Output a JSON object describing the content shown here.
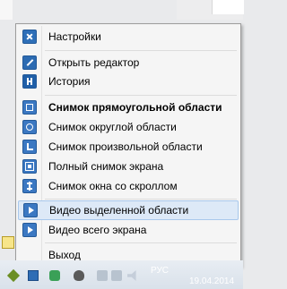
{
  "menu": {
    "items": [
      {
        "label": "Настройки",
        "icon": "settings-icon"
      },
      {
        "label": "Открыть редактор",
        "icon": "pencil-icon"
      },
      {
        "label": "История",
        "icon": "history-icon"
      },
      {
        "label": "Снимок прямоугольной области",
        "icon": "rectangle-capture-icon"
      },
      {
        "label": "Снимок округлой области",
        "icon": "round-capture-icon"
      },
      {
        "label": "Снимок произвольной области",
        "icon": "freeform-capture-icon"
      },
      {
        "label": "Полный снимок экрана",
        "icon": "fullscreen-capture-icon"
      },
      {
        "label": "Снимок окна со скроллом",
        "icon": "scroll-capture-icon"
      },
      {
        "label": "Видео выделенной области",
        "icon": "video-region-icon"
      },
      {
        "label": "Видео всего экрана",
        "icon": "video-fullscreen-icon"
      },
      {
        "label": "Выход",
        "icon": "exit-icon"
      }
    ]
  },
  "taskbar": {
    "language": "РУС",
    "date": "19.04.2014"
  },
  "colors": {
    "accent": "#3b78c2",
    "highlight": "#dde9f7",
    "menu_background": "#f5f5f5"
  }
}
